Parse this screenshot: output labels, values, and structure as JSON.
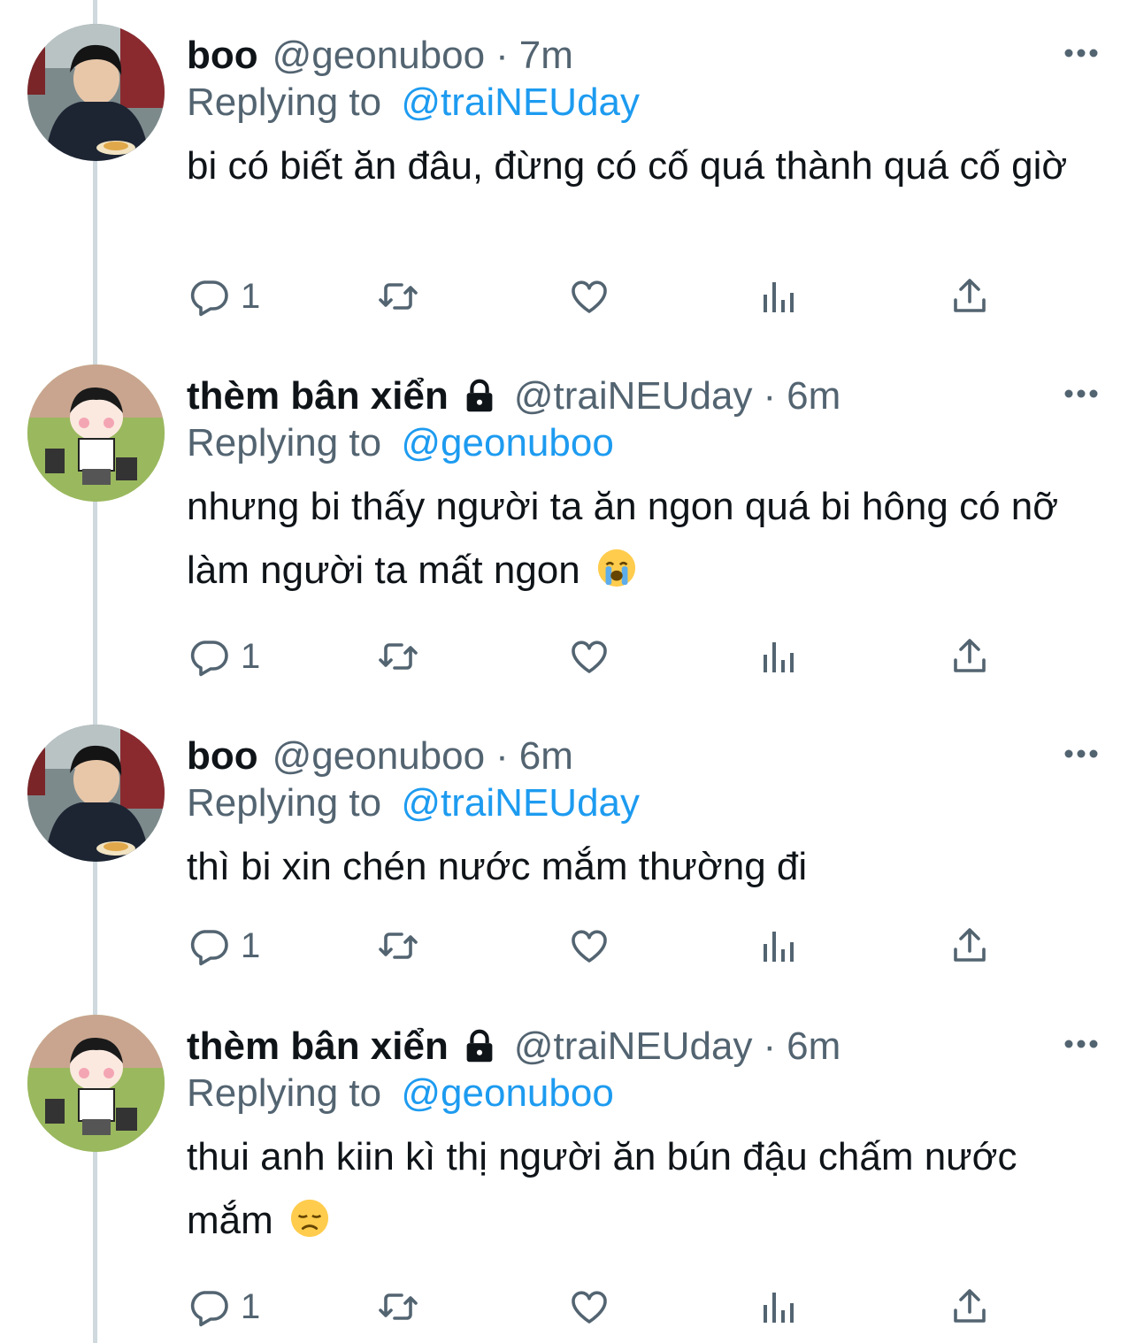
{
  "tweets": [
    {
      "name": "boo",
      "locked": false,
      "handle": "@geonuboo",
      "separator": "·",
      "time": "7m",
      "replying_label": "Replying to",
      "replying_to": "@traiNEUday",
      "text": "bi có biết ăn đâu, đừng có cố quá thành quá cố giờ",
      "emoji": "",
      "reply_count": "1"
    },
    {
      "name": "thèm bân xiển",
      "locked": true,
      "handle": "@traiNEUday",
      "separator": "·",
      "time": "6m",
      "replying_label": "Replying to",
      "replying_to": "@geonuboo",
      "text": "nhưng bi thấy người ta ăn ngon quá bi hông có nỡ làm người ta mất ngon",
      "emoji": "loudly-crying-face",
      "reply_count": "1"
    },
    {
      "name": "boo",
      "locked": false,
      "handle": "@geonuboo",
      "separator": "·",
      "time": "6m",
      "replying_label": "Replying to",
      "replying_to": "@traiNEUday",
      "text": "thì bi xin chén nước mắm thường đi",
      "emoji": "",
      "reply_count": "1"
    },
    {
      "name": "thèm bân xiển",
      "locked": true,
      "handle": "@traiNEUday",
      "separator": "·",
      "time": "6m",
      "replying_label": "Replying to",
      "replying_to": "@geonuboo",
      "text": "thui anh kiin kì thị người ăn bún đậu chấm nước mắm",
      "emoji": "disappointed-face",
      "reply_count": "1"
    }
  ],
  "icons": {
    "more": "more-horizontal-icon",
    "reply": "reply-bubble-icon",
    "retweet": "retweet-icon",
    "like": "heart-icon",
    "views": "views-bar-icon",
    "share": "share-upload-icon",
    "lock": "lock-icon"
  },
  "colors": {
    "text": "#0f1419",
    "secondary": "#536471",
    "link": "#1d9bf0",
    "thread_line": "#cfd9de"
  }
}
